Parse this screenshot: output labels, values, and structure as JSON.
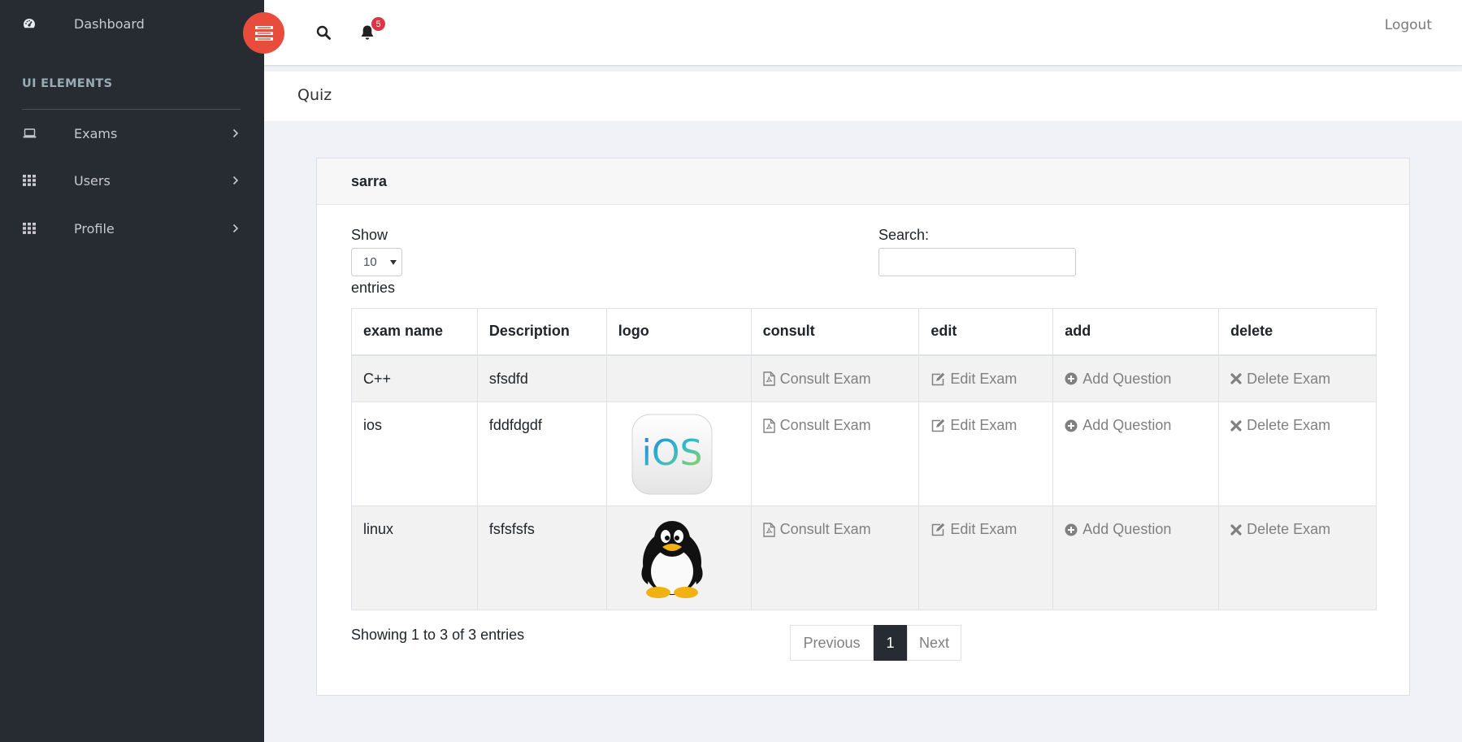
{
  "sidebar": {
    "dashboard_label": "Dashboard",
    "section_heading": "UI ELEMENTS",
    "items": [
      {
        "label": "Exams",
        "icon": "laptop-icon"
      },
      {
        "label": "Users",
        "icon": "grid-icon"
      },
      {
        "label": "Profile",
        "icon": "grid-icon"
      }
    ]
  },
  "header": {
    "notification_count": "5",
    "logout_label": "Logout",
    "accent_color": "#e74c3c"
  },
  "breadcrumb": {
    "title": "Quiz"
  },
  "card": {
    "title": "sarra",
    "show_label": "Show",
    "entries_label": "entries",
    "page_size": "10",
    "search_label": "Search:",
    "search_value": ""
  },
  "table": {
    "headers": [
      "exam name",
      "Description",
      "logo",
      "consult",
      "edit",
      "add",
      "delete"
    ],
    "rows": [
      {
        "name": "C++",
        "description": "sfsdfd",
        "logo": "",
        "consult": "Consult Exam",
        "edit": "Edit Exam",
        "add": "Add Question",
        "delete": "Delete Exam"
      },
      {
        "name": "ios",
        "description": "fddfdgdf",
        "logo": "ios-logo",
        "consult": "Consult Exam",
        "edit": "Edit Exam",
        "add": "Add Question",
        "delete": "Delete Exam"
      },
      {
        "name": "linux",
        "description": "fsfsfsfs",
        "logo": "linux-tux-logo",
        "consult": "Consult Exam",
        "edit": "Edit Exam",
        "add": "Add Question",
        "delete": "Delete Exam"
      }
    ]
  },
  "footer": {
    "info": "Showing 1 to 3 of 3 entries",
    "previous_label": "Previous",
    "current_page": "1",
    "next_label": "Next"
  }
}
